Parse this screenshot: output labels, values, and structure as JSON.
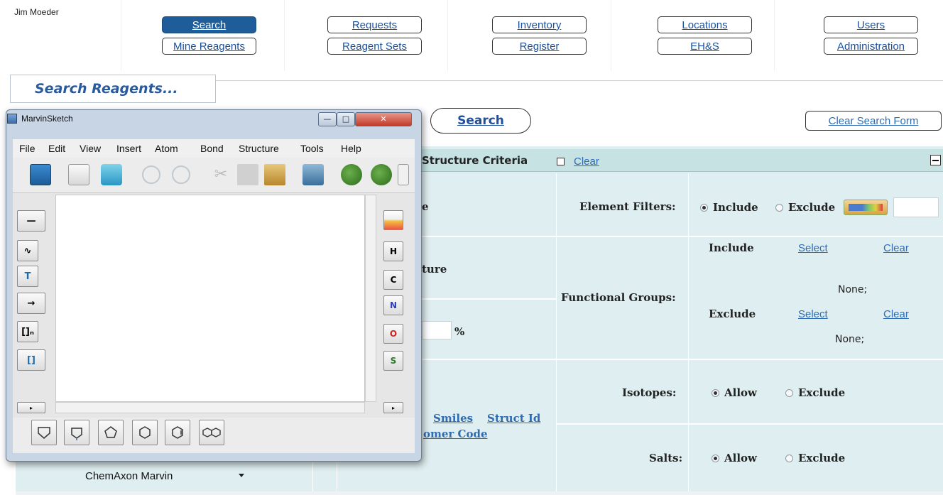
{
  "user": {
    "name": "Jim Moeder"
  },
  "nav": {
    "search": "Search",
    "mine_reagents": "Mine Reagents",
    "requests": "Requests",
    "reagent_sets": "Reagent Sets",
    "inventory": "Inventory",
    "register": "Register",
    "locations": "Locations",
    "ehs": "EH&S",
    "users": "Users",
    "administration": "Administration"
  },
  "page": {
    "title": "Search Reagents..."
  },
  "actions": {
    "search": "Search",
    "clear_form": "Clear Search Form"
  },
  "criteria": {
    "header": "Structure Criteria",
    "clear": "Clear",
    "left_fragments": {
      "e": "e",
      "ture": "ture",
      "percent": "%",
      "smiles": "Smiles",
      "struct_id": "Struct Id",
      "omer_code": "omer Code"
    },
    "element_filters": {
      "label": "Element Filters:",
      "include": "Include",
      "exclude": "Exclude",
      "mode": "include"
    },
    "functional_groups": {
      "label": "Functional Groups:",
      "include_label": "Include",
      "exclude_label": "Exclude",
      "select": "Select",
      "clear": "Clear",
      "include_value": "None;",
      "exclude_value": "None;"
    },
    "isotopes": {
      "label": "Isotopes:",
      "allow": "Allow",
      "exclude": "Exclude",
      "mode": "allow"
    },
    "salts": {
      "label": "Salts:",
      "allow": "Allow",
      "exclude": "Exclude",
      "mode": "allow"
    }
  },
  "editor_select": {
    "value": "ChemAxon Marvin"
  },
  "marvin": {
    "title": "MarvinSketch",
    "menus": [
      "File",
      "Edit",
      "View",
      "Insert",
      "Atom",
      "Bond",
      "Structure",
      "Tools",
      "Help"
    ],
    "atoms": [
      "H",
      "C",
      "N",
      "O",
      "S"
    ],
    "atom_colors": {
      "H": "#222222",
      "C": "#222222",
      "N": "#2a3fbf",
      "O": "#d02020",
      "S": "#2f7a2f"
    },
    "left_tools": {
      "text": "T",
      "bracket": "[]"
    }
  },
  "colors": {
    "nav_active": "#1f5c9a",
    "link": "#2f6cb4",
    "panel": "#dfeef0",
    "panel_header": "#c6e2e3"
  }
}
